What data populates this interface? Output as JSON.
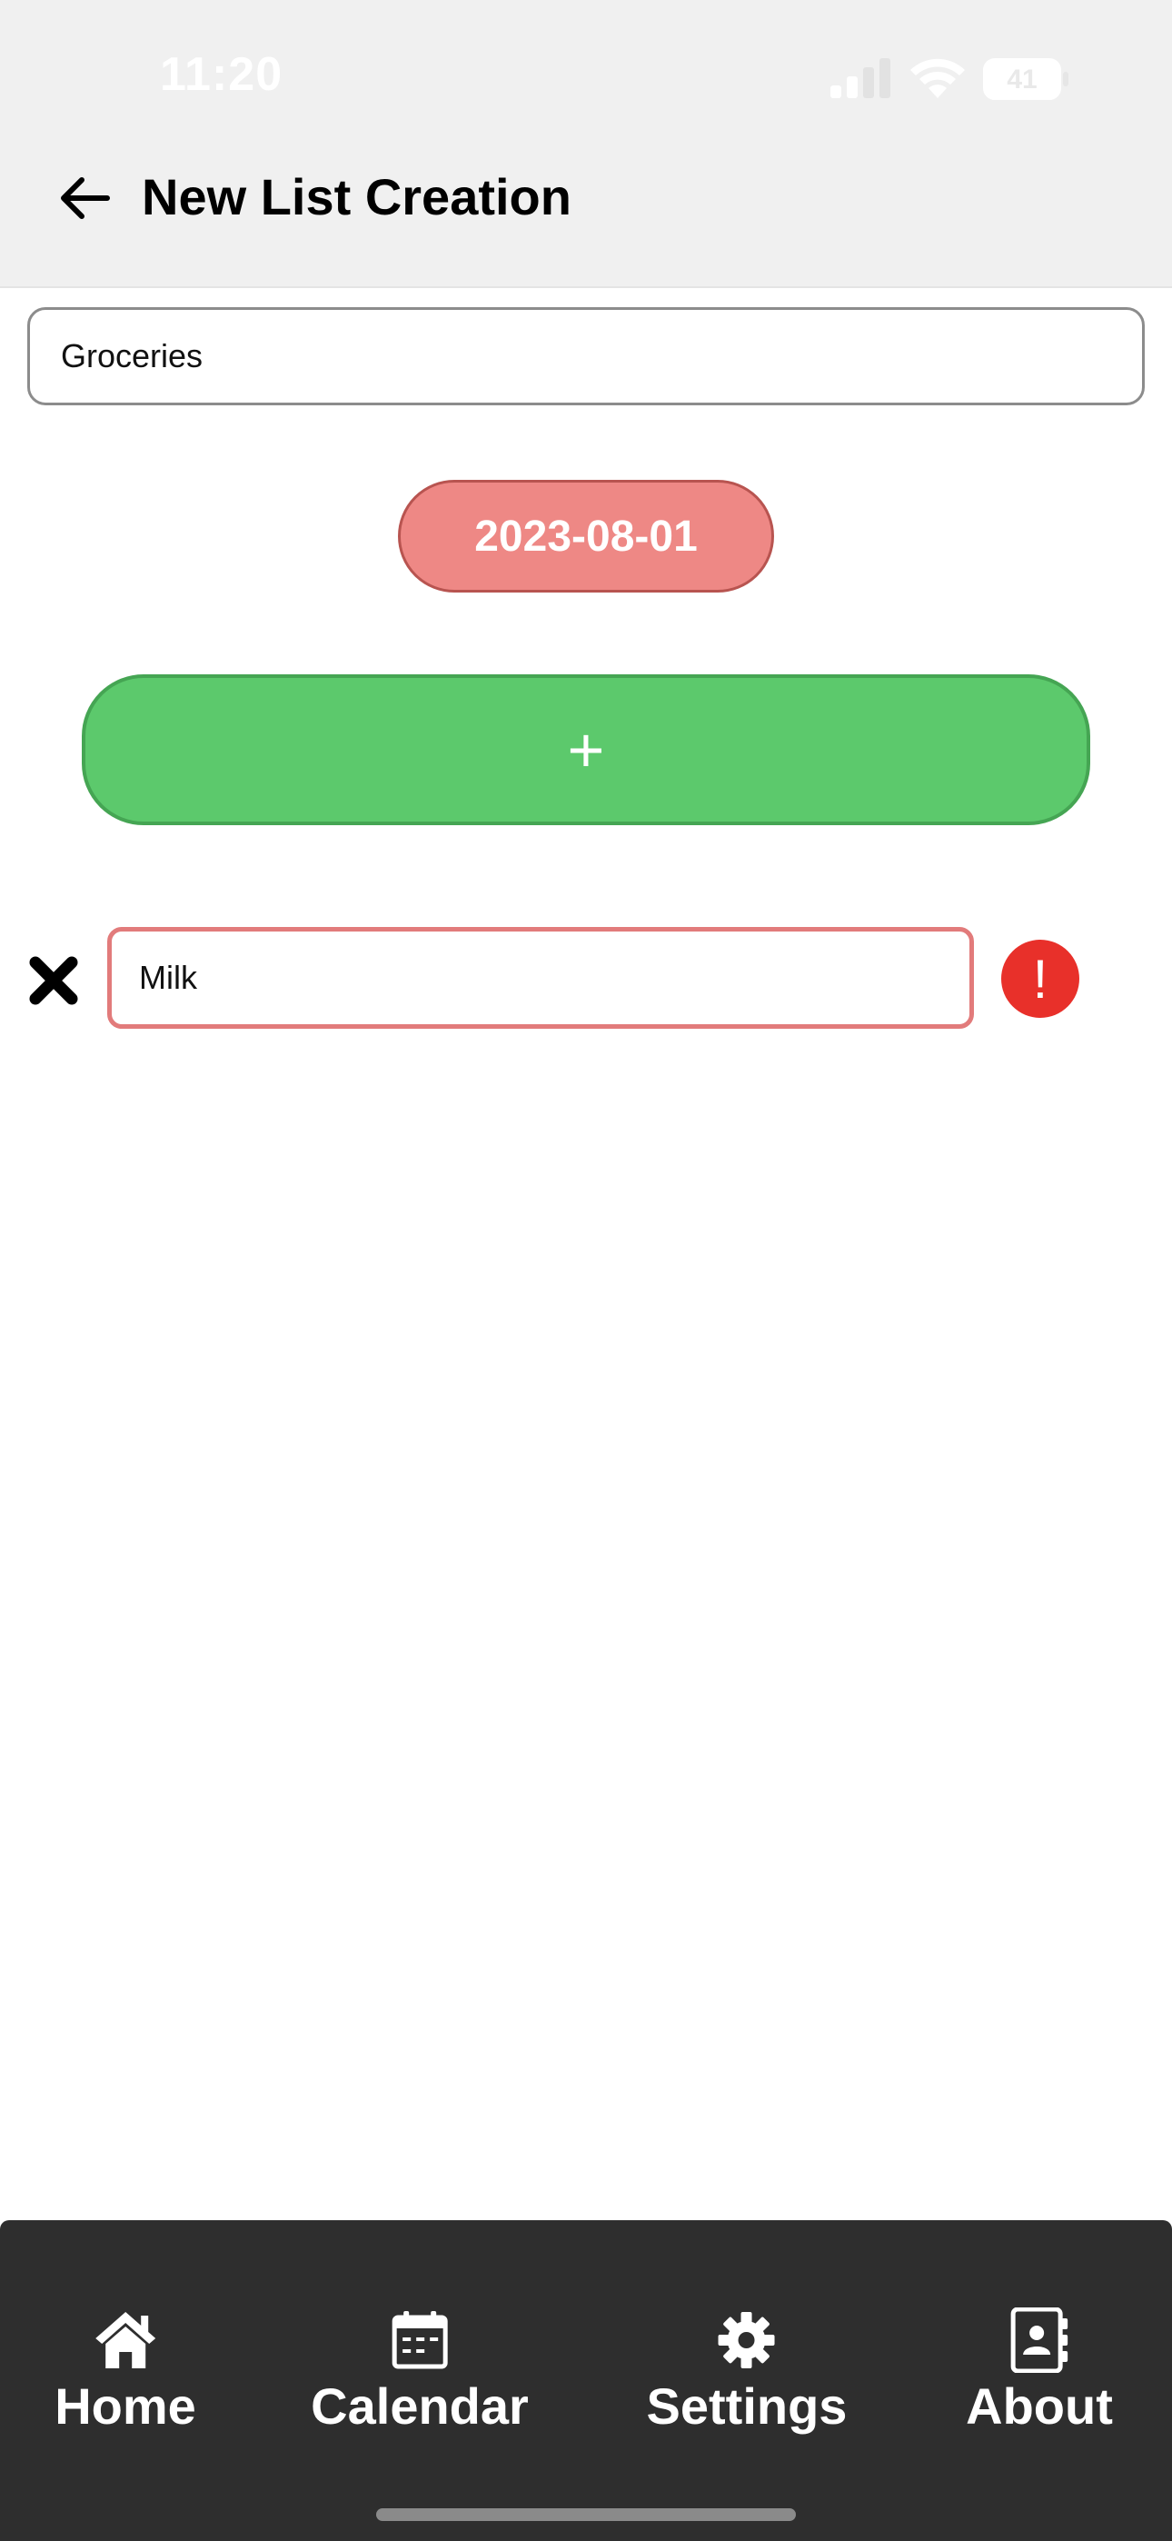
{
  "status_bar": {
    "time": "11:20",
    "battery": "41",
    "icons": [
      "signal-icon",
      "wifi-icon",
      "battery-icon"
    ]
  },
  "header": {
    "back_icon": "arrow-left-icon",
    "title": "New List Creation"
  },
  "form": {
    "list_name_value": "Groceries",
    "date_label": "2023-08-01",
    "add_button_label": "+",
    "items": [
      {
        "value": "Milk",
        "remove_icon": "close-x-icon",
        "error_icon": "exclamation-icon",
        "error_symbol": "!"
      }
    ]
  },
  "tab_bar": {
    "tabs": [
      {
        "label": "Home",
        "icon": "home-icon"
      },
      {
        "label": "Calendar",
        "icon": "calendar-icon"
      },
      {
        "label": "Settings",
        "icon": "gear-icon"
      },
      {
        "label": "About",
        "icon": "contact-book-icon"
      }
    ]
  },
  "colors": {
    "header_bg": "#f0f0f0",
    "date_button": "#ee8885",
    "add_button": "#5cc96c",
    "error_border": "#e27b7b",
    "error_icon": "#e8302a",
    "tab_bar_bg": "#2e2e2e"
  }
}
